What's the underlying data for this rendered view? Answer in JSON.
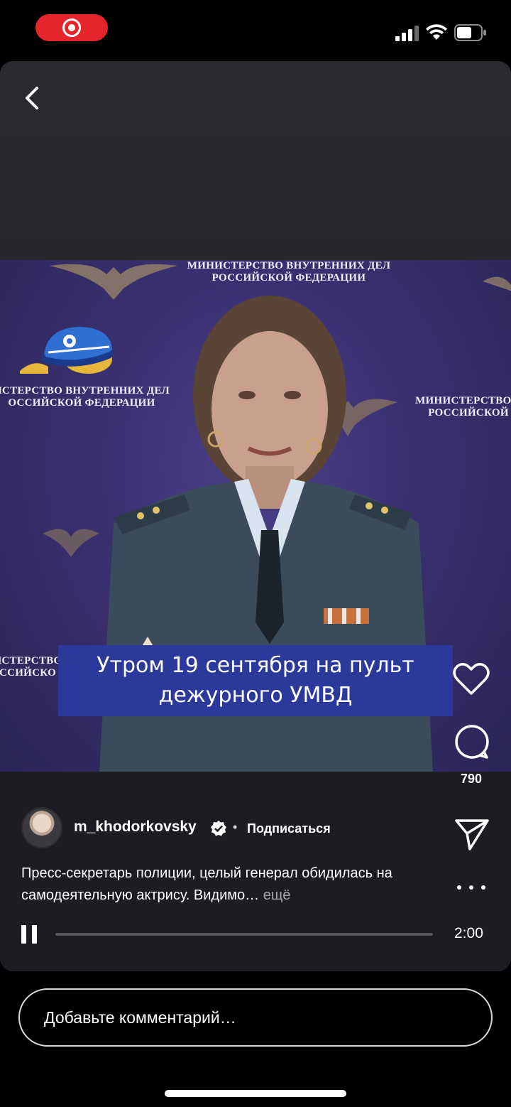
{
  "status_bar": {
    "recording_icon": "screen-record-icon",
    "signal_icon": "cellular-signal-icon",
    "wifi_icon": "wifi-icon",
    "battery_icon": "battery-icon",
    "recording_color": "#e5252c"
  },
  "header": {
    "back_icon": "chevron-left-icon"
  },
  "video": {
    "backdrop_text_top": "МИНИСТЕРСТВО ВНУТРЕННИХ ДЕЛ РОССИЙСКОЙ ФЕДЕРАЦИИ",
    "backdrop_text_left": "ИСТЕРСТВО ВНУТРЕННИХ ДЕЛ ОССИЙСКОЙ ФЕДЕРАЦИИ",
    "backdrop_text_right": "МИНИСТЕРСТВО В РОССИЙСКОЙ",
    "backdrop_text_bottom": "ИСТЕРСТВО ССИЙСКО",
    "caption_line1": "Утром 19 сентября на пульт",
    "caption_line2": "дежурного УМВД",
    "caption_bg_color": "#2b3a9a"
  },
  "actions": {
    "like_icon": "heart-icon",
    "comment_icon": "comment-bubble-icon",
    "comment_count": "790",
    "share_icon": "send-icon",
    "more_icon": "more-horizontal-icon"
  },
  "author": {
    "username": "m_khodorkovsky",
    "verified_icon": "verified-badge-icon",
    "separator": "•",
    "follow_label": "Подписаться"
  },
  "post": {
    "description": "Пресс-секретарь полиции, целый генерал обидилась на самодеятельную актрису. Видимо…",
    "more_label": "ещё"
  },
  "playback": {
    "pause_icon": "pause-icon",
    "progress": 0.0,
    "time": "2:00"
  },
  "comment_box": {
    "placeholder": "Добавьте комментарий…"
  }
}
